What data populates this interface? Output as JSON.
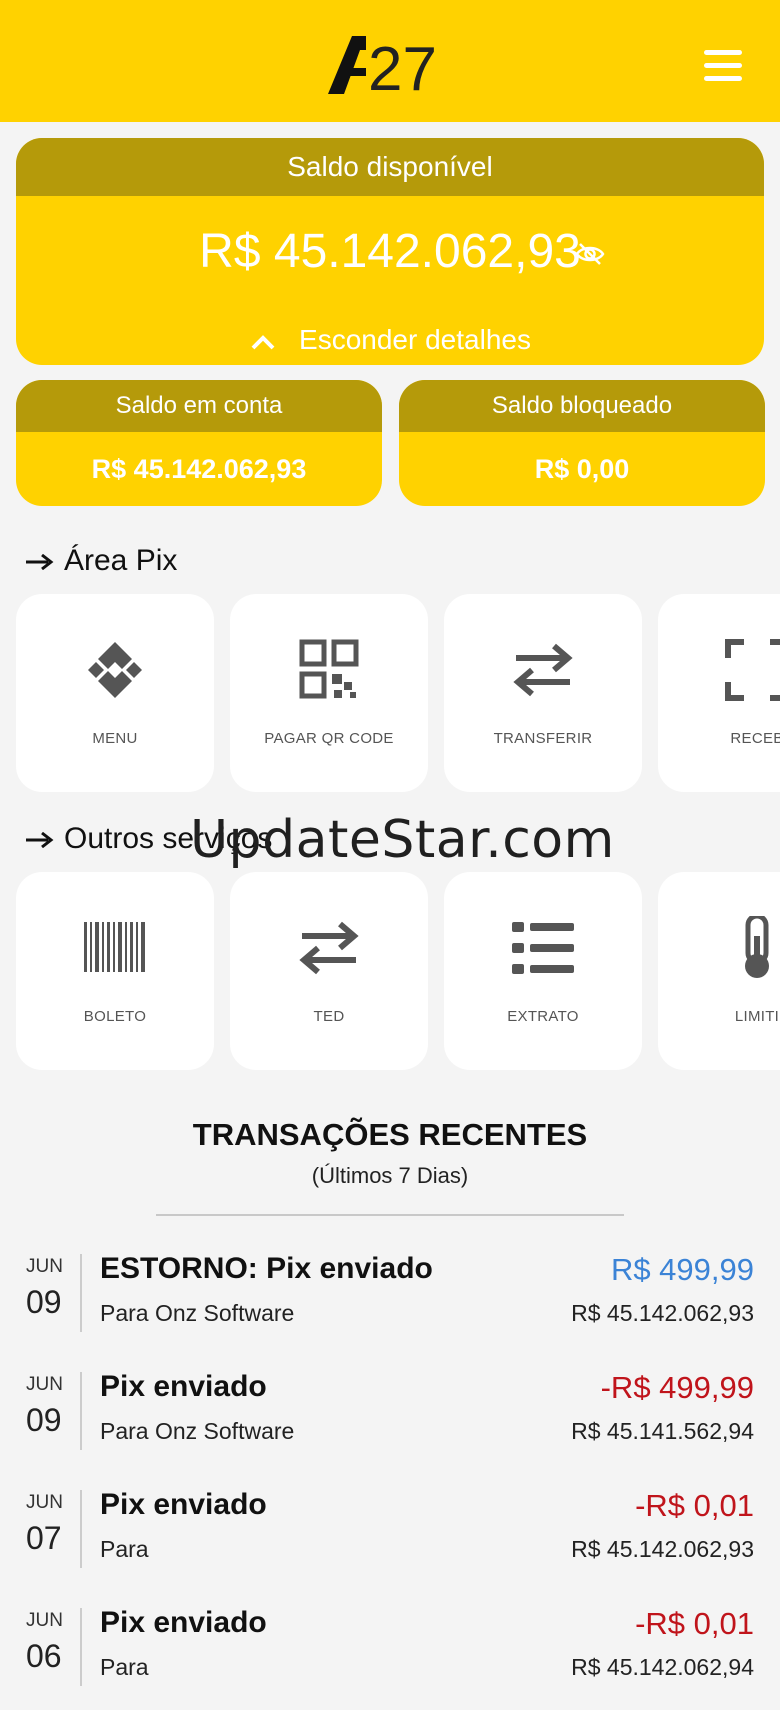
{
  "header": {
    "logo_alt": "A27",
    "logo_text": "27",
    "menu_icon": "hamburger-icon"
  },
  "balance": {
    "title": "Saldo disponível",
    "amount": "R$ 45.142.062,93",
    "visibility_icon": "eye-off-icon",
    "toggle_label": "Esconder detalhes"
  },
  "sub_balances": [
    {
      "title": "Saldo em conta",
      "value": "R$ 45.142.062,93"
    },
    {
      "title": "Saldo bloqueado",
      "value": "R$ 0,00"
    }
  ],
  "pix": {
    "title": "Área Pix",
    "tiles": [
      {
        "label": "MENU",
        "icon": "pix-icon"
      },
      {
        "label": "PAGAR QR CODE",
        "icon": "qr-code-icon"
      },
      {
        "label": "TRANSFERIR",
        "icon": "transfer-icon"
      },
      {
        "label": "RECEB",
        "icon": "scan-icon"
      }
    ]
  },
  "services": {
    "title": "Outros serviços",
    "tiles": [
      {
        "label": "BOLETO",
        "icon": "barcode-icon"
      },
      {
        "label": "TED",
        "icon": "transfer-icon"
      },
      {
        "label": "EXTRATO",
        "icon": "list-icon"
      },
      {
        "label": "LIMITI",
        "icon": "thermometer-icon"
      }
    ]
  },
  "watermark": "UpdateStar.com",
  "transactions": {
    "title": "TRANSAÇÕES RECENTES",
    "subtitle": "(Últimos 7 Dias)",
    "items": [
      {
        "month": "JUN",
        "day": "09",
        "title": "ESTORNO: Pix enviado",
        "description": "Para Onz Software",
        "amount": "R$ 499,99",
        "balance": "R$ 45.142.062,93",
        "type": "credit"
      },
      {
        "month": "JUN",
        "day": "09",
        "title": "Pix enviado",
        "description": "Para Onz Software",
        "amount": "-R$ 499,99",
        "balance": "R$ 45.141.562,94",
        "type": "debit"
      },
      {
        "month": "JUN",
        "day": "07",
        "title": "Pix enviado",
        "description": "Para",
        "amount": "-R$ 0,01",
        "balance": "R$ 45.142.062,93",
        "type": "debit"
      },
      {
        "month": "JUN",
        "day": "06",
        "title": "Pix enviado",
        "description": "Para",
        "amount": "-R$ 0,01",
        "balance": "R$ 45.142.062,94",
        "type": "debit"
      }
    ]
  },
  "colors": {
    "brand_yellow": "#ffd200",
    "header_olive": "#b59a0a",
    "credit": "#3b83d6",
    "debit": "#c0141b"
  }
}
